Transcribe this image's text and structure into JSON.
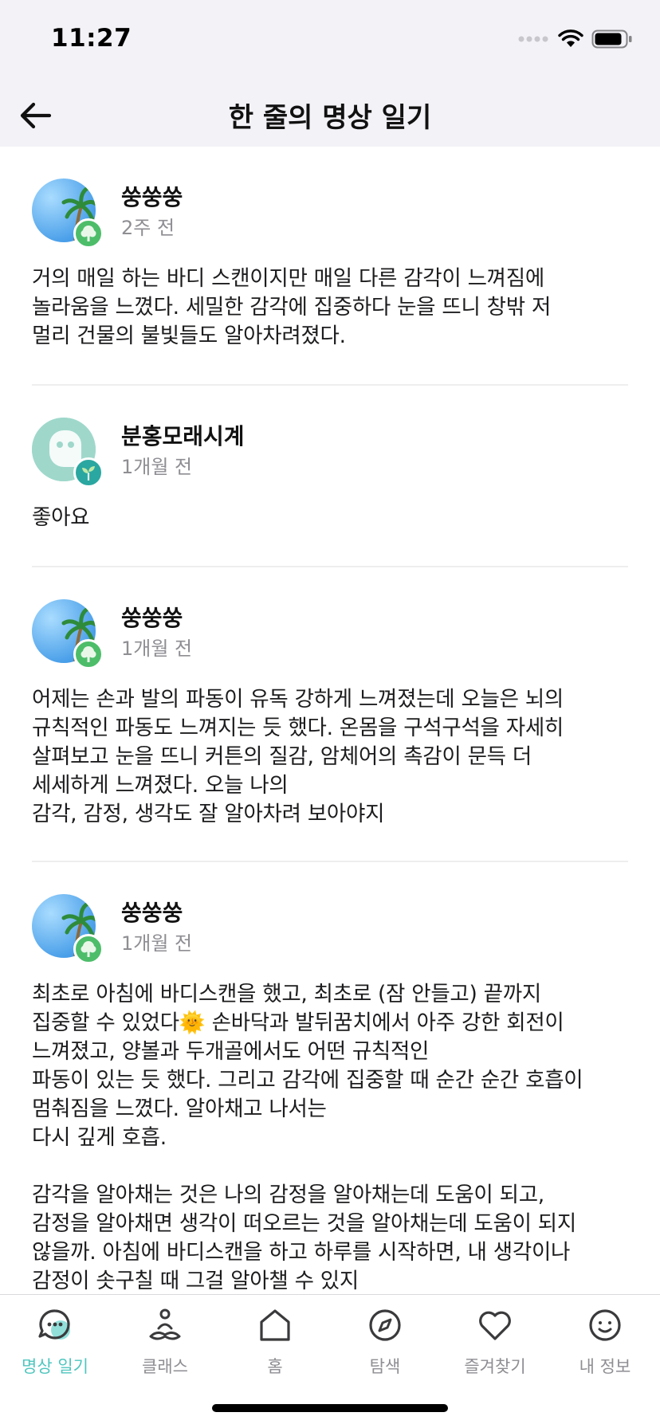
{
  "status_bar": {
    "time": "11:27",
    "signal_icon": "signal-dots-icon",
    "wifi_icon": "wifi-icon",
    "battery_icon": "battery-icon"
  },
  "nav": {
    "title": "한 줄의 명상 일기",
    "back_icon": "arrow-left-icon"
  },
  "posts": [
    {
      "author": "쑹쑹쑹",
      "time_ago": "2주 전",
      "avatar": "palm-tree-avatar",
      "badge": "tree-badge",
      "body": "거의 매일 하는 바디 스캔이지만 매일 다른 감각이 느껴짐에\n놀라움을 느꼈다. 세밀한 감각에 집중하다 눈을 뜨니 창밖 저\n멀리 건물의 불빛들도 알아차려졌다."
    },
    {
      "author": "분홍모래시계",
      "time_ago": "1개월 전",
      "avatar": "mint-face-avatar",
      "badge": "sprout-badge",
      "body": "좋아요"
    },
    {
      "author": "쑹쑹쑹",
      "time_ago": "1개월 전",
      "avatar": "palm-tree-avatar",
      "badge": "tree-badge",
      "body": "어제는 손과 발의 파동이 유독 강하게 느껴졌는데 오늘은 뇌의\n규칙적인 파동도 느껴지는 듯 했다. 온몸을 구석구석을 자세히\n살펴보고 눈을 뜨니 커튼의 질감, 암체어의 촉감이 문득 더\n세세하게 느껴졌다. 오늘 나의\n감각, 감정, 생각도 잘 알아차려 보아야지"
    },
    {
      "author": "쑹쑹쑹",
      "time_ago": "1개월 전",
      "avatar": "palm-tree-avatar",
      "badge": "tree-badge",
      "body_before_emoji": "최초로 아침에 바디스캔을 했고, 최초로 (잠 안들고) 끝까지\n집중할 수 있었다",
      "emoji": "🌞",
      "body_after_emoji": " 손바닥과 발뒤꿈치에서 아주 강한 회전이\n느껴졌고, 양볼과 두개골에서도 어떤 규칙적인\n파동이 있는 듯 했다. 그리고 감각에 집중할 때 순간 순간 호흡이\n멈춰짐을 느꼈다. 알아채고 나서는\n다시 깊게 호흡.\n\n감각을 알아채는 것은 나의 감정을 알아채는데 도움이 되고,\n감정을 알아채면 생각이 떠오르는 것을 알아채는데 도움이 되지\n않을까. 아침에 바디스캔을 하고 하루를 시작하면, 내 생각이나\n감정이 솟구칠 때 그걸 알아챌 수 있지"
    }
  ],
  "tab_bar": {
    "active_color": "#4fc6bf",
    "inactive_color": "#8e8e93",
    "tabs": [
      {
        "label": "명상 일기",
        "icon": "chat-bubble-icon",
        "active": true
      },
      {
        "label": "클래스",
        "icon": "meditation-person-icon",
        "active": false
      },
      {
        "label": "홈",
        "icon": "home-icon",
        "active": false
      },
      {
        "label": "탐색",
        "icon": "compass-icon",
        "active": false
      },
      {
        "label": "즐겨찾기",
        "icon": "heart-icon",
        "active": false
      },
      {
        "label": "내 정보",
        "icon": "smiley-icon",
        "active": false
      }
    ]
  }
}
